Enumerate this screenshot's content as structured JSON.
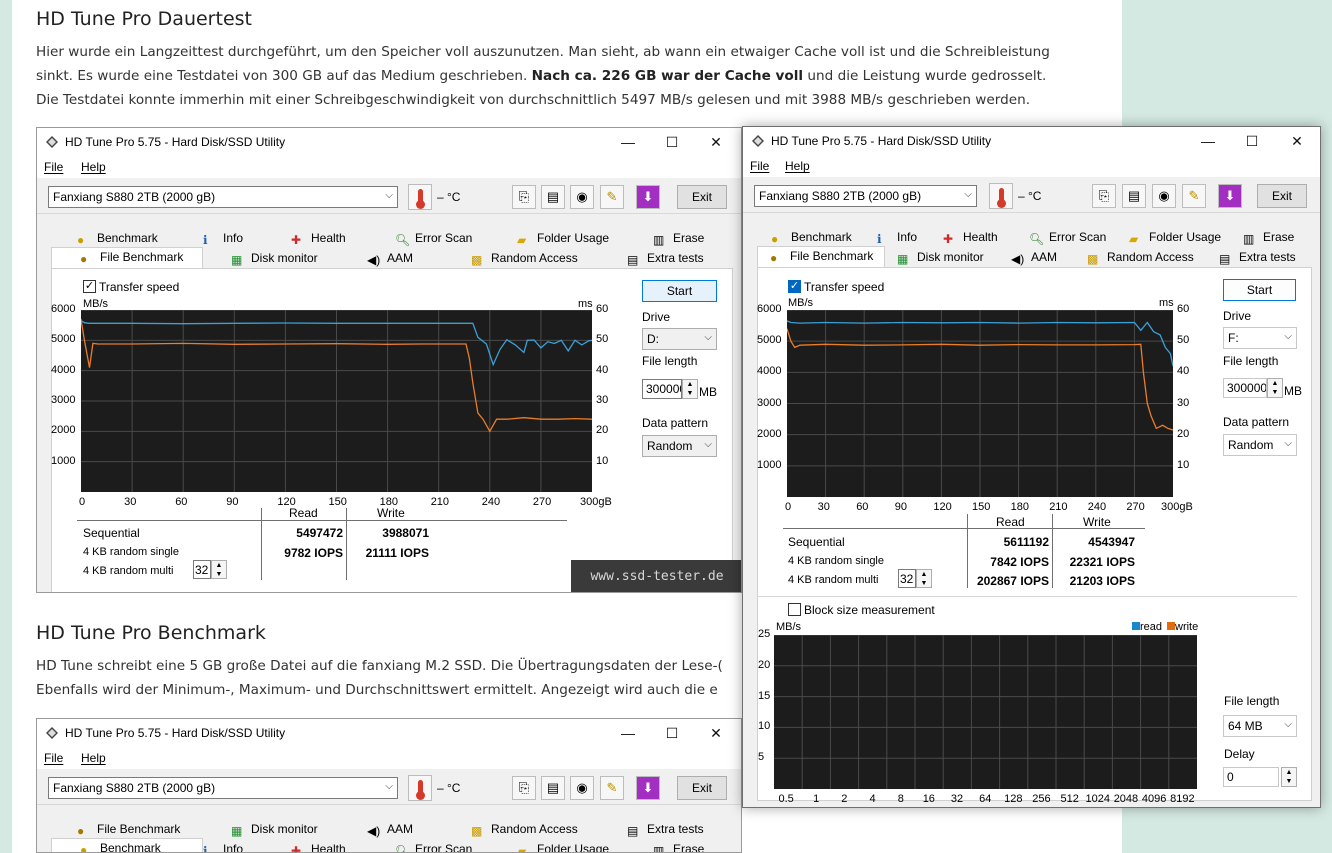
{
  "article": {
    "h1": "HD Tune Pro Dauertest",
    "p1_line1": "Hier wurde ein Langzeittest durchgeführt, um den Speicher voll auszunutzen. Man sieht, ab wann ein etwaiger Cache voll ist und die Schreibleistung",
    "p1_line2a": "sinkt. Es wurde eine Testdatei von 300 GB auf das Medium geschrieben.",
    "p1_line2b": "Nach ca. 226 GB war der Cache voll",
    "p1_line2c": "und die Leistung wurde gedrosselt.",
    "p1_line3": "Die Testdatei konnte immerhin mit einer Schreibgeschwindigkeit von durchschnittlich 5497 MB/s gelesen und mit 3988 MB/s geschrieben werden.",
    "h2": "HD Tune Pro Benchmark",
    "p2_line1": "HD Tune schreibt eine 5 GB große Datei auf die fanxiang M.2 SSD. Die Übertragungsdaten der Lese-(",
    "p2_line2": "Ebenfalls wird der Minimum-, Maximum- und Durchschnittswert ermittelt. Angezeigt wird auch die e"
  },
  "app": {
    "title": "HD Tune Pro 5.75 - Hard Disk/SSD Utility",
    "menu_file": "File",
    "menu_help": "Help",
    "drive_select": "Fanxiang S880 2TB (2000 gB)",
    "temp": "– °C",
    "exit": "Exit",
    "tabs_top": [
      "Benchmark",
      "Info",
      "Health",
      "Error Scan",
      "Folder Usage",
      "Erase"
    ],
    "tabs_bottom": [
      "File Benchmark",
      "Disk monitor",
      "AAM",
      "Random Access",
      "Extra tests"
    ],
    "transfer_speed": "Transfer speed",
    "start": "Start",
    "drive_label": "Drive",
    "file_length_label": "File length",
    "data_pattern_label": "Data pattern",
    "pattern_value": "Random",
    "mb": "MB",
    "mbs_axis": "MB/s",
    "ms_axis": "ms",
    "col_read": "Read",
    "col_write": "Write",
    "row_sequential": "Sequential",
    "row_4k_single": "4 KB random single",
    "row_4k_multi": "4 KB random multi",
    "queue_depth": "32",
    "watermark": "www.ssd-tester.de"
  },
  "left_window": {
    "drive_letter": "D:",
    "file_length": "300000",
    "seq_read": "5497472",
    "seq_write": "3988071",
    "single_read": "9782 IOPS",
    "single_write": "21111 IOPS"
  },
  "right_window": {
    "drive_letter": "F:",
    "file_length": "300000",
    "seq_read": "5611192",
    "seq_write": "4543947",
    "single_read": "7842 IOPS",
    "single_write": "22321 IOPS",
    "multi_read": "202867 IOPS",
    "multi_write": "21203 IOPS",
    "block_size_measurement": "Block size measurement",
    "legend_read": "read",
    "legend_write": "write",
    "bs_file_length_label": "File length",
    "bs_file_length_value": "64 MB",
    "delay_label": "Delay",
    "delay_value": "0"
  },
  "chart_data": [
    {
      "type": "line",
      "title": "",
      "xlabel": "gB",
      "ylabel": "MB/s",
      "x_ticks": [
        "0",
        "30",
        "60",
        "90",
        "120",
        "150",
        "180",
        "210",
        "240",
        "270",
        "300gB"
      ],
      "y_ticks": [
        "6000",
        "5000",
        "4000",
        "3000",
        "2000",
        "1000"
      ],
      "y2_ticks": [
        "60",
        "50",
        "40",
        "30",
        "20",
        "10"
      ],
      "xlim": [
        0,
        300
      ],
      "ylim": [
        0,
        6000
      ],
      "series": [
        {
          "name": "read",
          "color": "#3aa0d8",
          "x": [
            0,
            2,
            5,
            10,
            30,
            60,
            90,
            120,
            150,
            180,
            200,
            220,
            230,
            233,
            238,
            242,
            246,
            250,
            255,
            260,
            262,
            266,
            270,
            274,
            278,
            282,
            286,
            290,
            294,
            298,
            300
          ],
          "values": [
            5650,
            5580,
            5560,
            5560,
            5560,
            5550,
            5560,
            5570,
            5560,
            5560,
            5560,
            5560,
            5560,
            5100,
            4880,
            4200,
            4700,
            5020,
            4850,
            4600,
            5000,
            5010,
            4750,
            4950,
            4900,
            5000,
            4650,
            5000,
            4850,
            4980,
            5000
          ]
        },
        {
          "name": "write",
          "color": "#e87d2a",
          "x": [
            0,
            2,
            5,
            7,
            10,
            30,
            60,
            90,
            120,
            150,
            180,
            200,
            220,
            226,
            228,
            230,
            233,
            236,
            240,
            244,
            250,
            260,
            270,
            280,
            290,
            300
          ],
          "values": [
            5700,
            5000,
            4100,
            4900,
            4880,
            4880,
            4900,
            4870,
            4880,
            4890,
            4870,
            4880,
            4880,
            4880,
            4400,
            3600,
            2600,
            2400,
            2000,
            2400,
            2400,
            2450,
            2400,
            2400,
            2420,
            2400
          ]
        }
      ]
    },
    {
      "type": "line",
      "title": "",
      "xlabel": "gB",
      "ylabel": "MB/s",
      "x_ticks": [
        "0",
        "30",
        "60",
        "90",
        "120",
        "150",
        "180",
        "210",
        "240",
        "270",
        "300gB"
      ],
      "y_ticks": [
        "6000",
        "5000",
        "4000",
        "3000",
        "2000",
        "1000"
      ],
      "y2_ticks": [
        "60",
        "50",
        "40",
        "30",
        "20",
        "10"
      ],
      "xlim": [
        0,
        300
      ],
      "ylim": [
        0,
        6000
      ],
      "series": [
        {
          "name": "read",
          "color": "#3aa0d8",
          "x": [
            0,
            3,
            10,
            30,
            60,
            90,
            120,
            150,
            180,
            210,
            240,
            270,
            275,
            280,
            285,
            290,
            294,
            298,
            300
          ],
          "values": [
            5650,
            5600,
            5580,
            5600,
            5580,
            5600,
            5590,
            5600,
            5580,
            5600,
            5590,
            5600,
            5350,
            5600,
            5300,
            5200,
            4800,
            4600,
            4200
          ]
        },
        {
          "name": "write",
          "color": "#e87d2a",
          "x": [
            0,
            3,
            6,
            10,
            30,
            60,
            90,
            120,
            150,
            180,
            210,
            240,
            270,
            275,
            277,
            280,
            283,
            287,
            292,
            296,
            300
          ],
          "values": [
            5400,
            5000,
            4800,
            4870,
            4900,
            4870,
            4880,
            4900,
            4870,
            4890,
            4880,
            4880,
            4890,
            4900,
            4000,
            3000,
            2600,
            2200,
            2300,
            2200,
            2150
          ]
        }
      ]
    },
    {
      "type": "line",
      "title": "",
      "xlabel": "",
      "ylabel": "MB/s",
      "categories": [
        "0.5",
        "1",
        "2",
        "4",
        "8",
        "16",
        "32",
        "64",
        "128",
        "256",
        "512",
        "1024",
        "2048",
        "4096",
        "8192"
      ],
      "y_ticks": [
        "25",
        "20",
        "15",
        "10",
        "5"
      ],
      "ylim": [
        0,
        25
      ],
      "series": [
        {
          "name": "read",
          "color": "#1a86d0",
          "values": []
        },
        {
          "name": "write",
          "color": "#e06c0e",
          "values": []
        }
      ]
    }
  ]
}
